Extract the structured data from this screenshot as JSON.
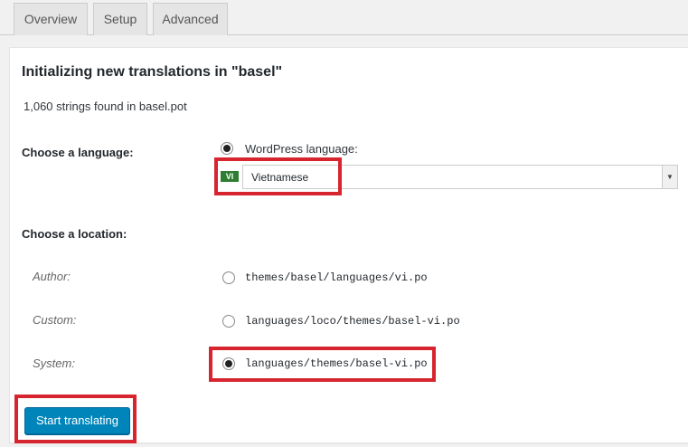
{
  "tabs": [
    "Overview",
    "Setup",
    "Advanced"
  ],
  "title": "Initializing new translations in \"basel\"",
  "strings_found": "1,060 strings found in basel.pot",
  "language": {
    "label": "Choose a language:",
    "wp_option_label": "WordPress language:",
    "wp_option_checked": true,
    "flag_code": "VI",
    "selected": "Vietnamese"
  },
  "location": {
    "label": "Choose a location:",
    "options": [
      {
        "label": "Author:",
        "path": "themes/basel/languages/vi.po",
        "checked": false
      },
      {
        "label": "Custom:",
        "path": "languages/loco/themes/basel-vi.po",
        "checked": false
      },
      {
        "label": "System:",
        "path": "languages/themes/basel-vi.po",
        "checked": true
      }
    ]
  },
  "start_button": "Start translating",
  "colors": {
    "highlight": "#d72530",
    "primary_button": "#0085ba",
    "flag": "#2f7d32"
  }
}
